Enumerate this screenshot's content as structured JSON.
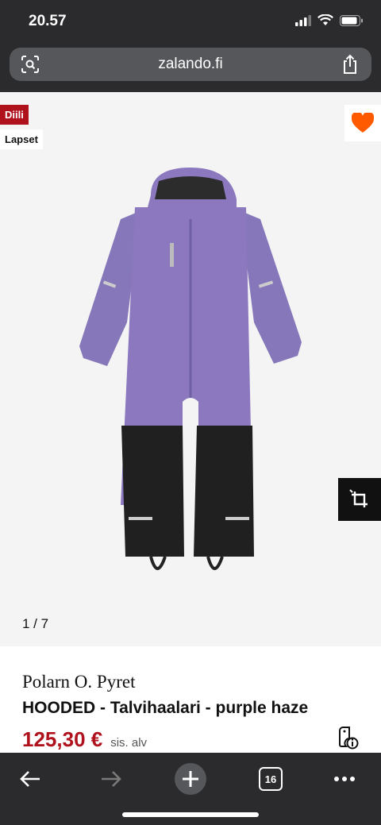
{
  "status": {
    "time": "20.57"
  },
  "browser": {
    "url": "zalando.fi",
    "tab_count": "16"
  },
  "product": {
    "badges": {
      "deal": "Diili",
      "category": "Lapset"
    },
    "image_pager": "1 / 7",
    "brand": "Polarn O. Pyret",
    "name": "HOODED - Talvihaalari - purple haze",
    "price": "125,30 €",
    "vat_note": "sis. alv",
    "colors": {
      "price": "#b0121d",
      "wishlist": "#ff5a00",
      "garment": "#8b78bf"
    }
  },
  "icons": [
    "signal-icon",
    "wifi-icon",
    "battery-icon",
    "screen-search-icon",
    "share-icon",
    "heart-icon",
    "crop-icon",
    "price-info-icon",
    "back-arrow-icon",
    "forward-arrow-icon",
    "new-tab-icon",
    "tabs-icon",
    "more-icon"
  ]
}
